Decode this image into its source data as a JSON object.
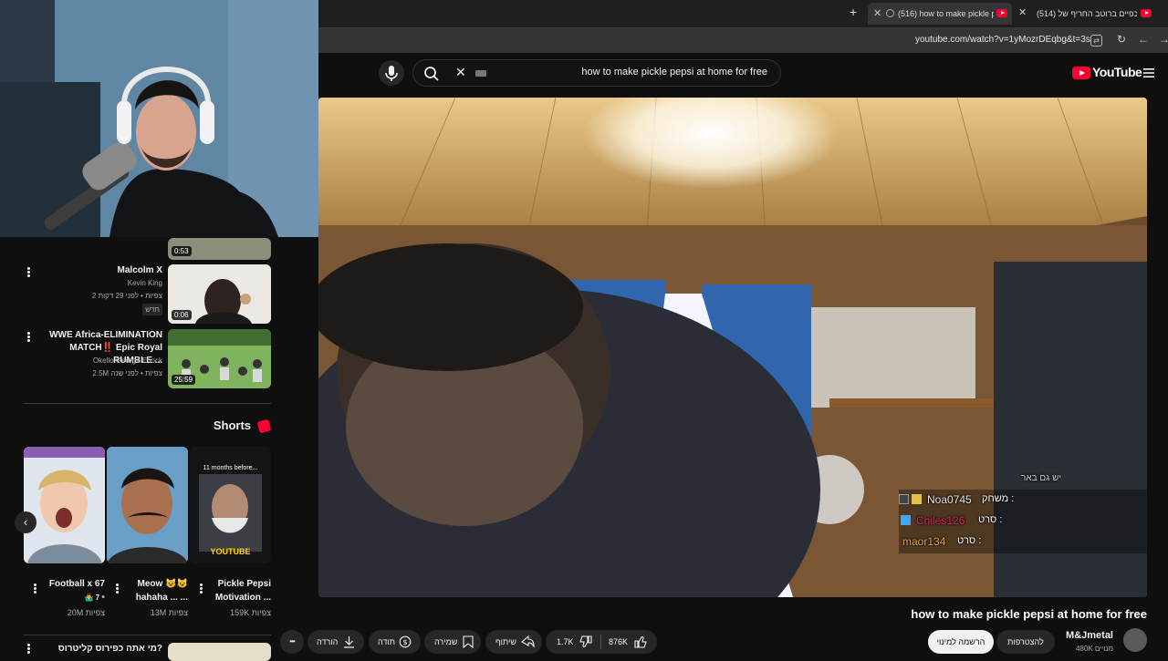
{
  "browser": {
    "tabs": [
      {
        "title": "(516) how to make pickle p",
        "active": true
      },
      {
        "title": "(514) כפיים ברוטב החריף של",
        "active": false
      }
    ],
    "new_tab_glyph": "+",
    "url": "youtube.com/watch?v=1yMozrDEqbg&t=3s"
  },
  "header": {
    "search_query": "how to make pickle pepsi at home for free",
    "logo_text": "YouTube"
  },
  "sidebar": {
    "recommendations": [
      {
        "duration": "0:53"
      },
      {
        "title": "Malcolm X",
        "channel": "Kevin King",
        "meta": "2 צפיות • לפני 29 דקות",
        "badge": "חדש",
        "duration": "0:06"
      },
      {
        "title_line1": "WWE Africa-ELIMINATION",
        "title_line2": "MATCH‼️ Epic Royal RUMBLE ...",
        "channel": "Okello George Enock",
        "meta": "2.5M צפיות • לפני שנה",
        "duration": "25:59"
      }
    ],
    "shorts_heading": "Shorts",
    "shorts": [
      {
        "title_line1": "Football x 67",
        "title_line2": "🤷‍♂️ 7 ⁶",
        "views": "20M צפיות"
      },
      {
        "title_line1": "Meow 😺😺",
        "title_line2": "hahaha ... ...",
        "views": "13M צפיות"
      },
      {
        "title_line1": "Pickle Pepsi",
        "title_line2": "Motivation ...",
        "views": "159K צפיות",
        "thumb_top_text": "11 months before...",
        "thumb_logo_text": "YOUTUBE"
      }
    ],
    "next_item_title": "מי אתה כפירוס קליטרוס?"
  },
  "chat": {
    "header_partial": "יש גם באר",
    "messages": [
      {
        "label": "משחק :",
        "user": "Noa0745",
        "user_color": "#e8e8e8"
      },
      {
        "label": "סרט :",
        "user": "Chiles126",
        "user_color": "#e0245e"
      },
      {
        "label": "סרט :",
        "user": "maor134",
        "user_color": "#e8a33d"
      }
    ]
  },
  "video": {
    "title": "how to make pickle pepsi at home for free",
    "channel": "M&Jmetal",
    "subscribers": "480K מנויים",
    "join_label": "להצטרפות",
    "subscribe_label": "הרשמה למינוי",
    "like_count": "876K",
    "dislike_count": "1.7K",
    "share_label": "שיתוף",
    "save_label": "שמירה",
    "thanks_label": "תודה",
    "download_label": "הורדה",
    "more_glyph": "•••"
  }
}
